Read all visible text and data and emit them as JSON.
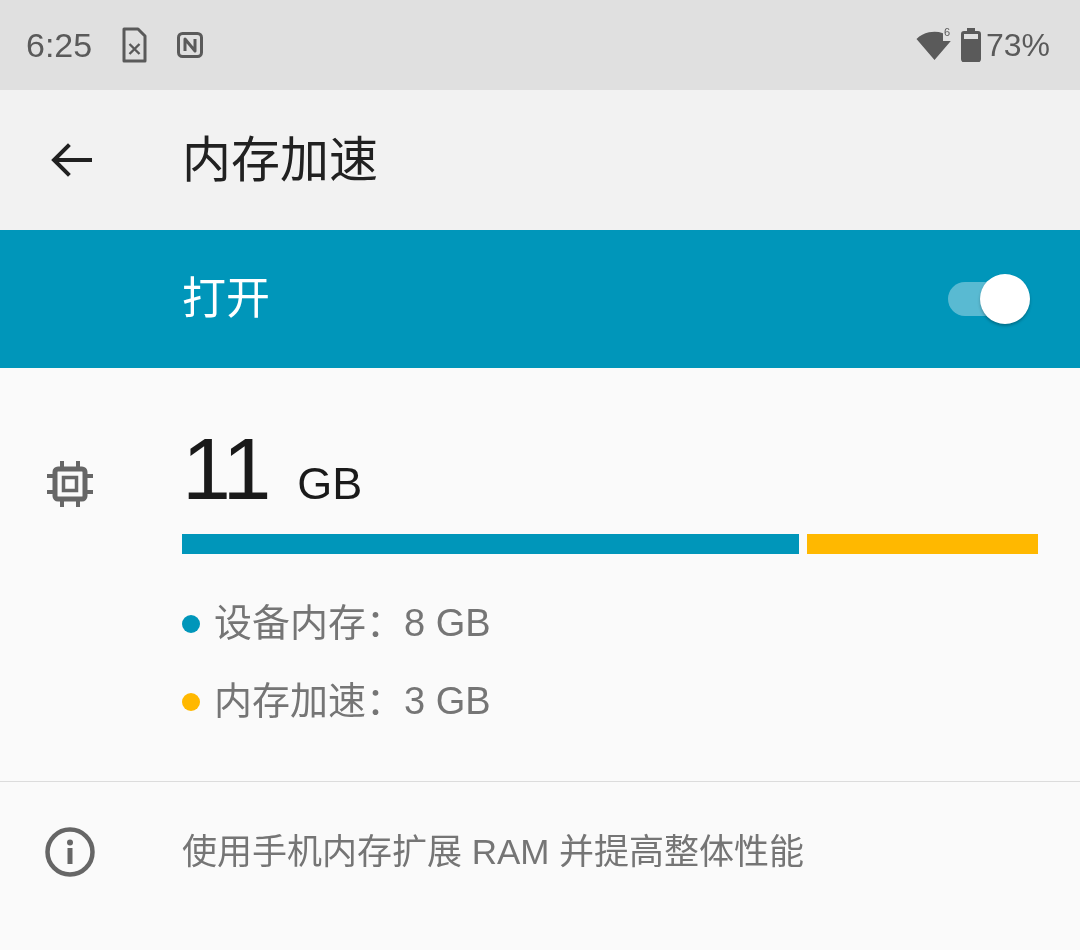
{
  "status_bar": {
    "time": "6:25",
    "wifi_badge": "6",
    "battery": "73%"
  },
  "app_bar": {
    "title": "内存加速"
  },
  "master_switch": {
    "label": "打开",
    "on": true
  },
  "memory": {
    "total": "11",
    "unit": "GB",
    "usage_bar": {
      "level": 0.73
    },
    "legend": [
      {
        "label": "设备内存：8 GB",
        "color": "#0096ba"
      },
      {
        "label": "内存加速：3 GB",
        "color": "#ffb800"
      }
    ]
  },
  "info": {
    "text": "使用手机内存扩展 RAM 并提高整体性能"
  }
}
